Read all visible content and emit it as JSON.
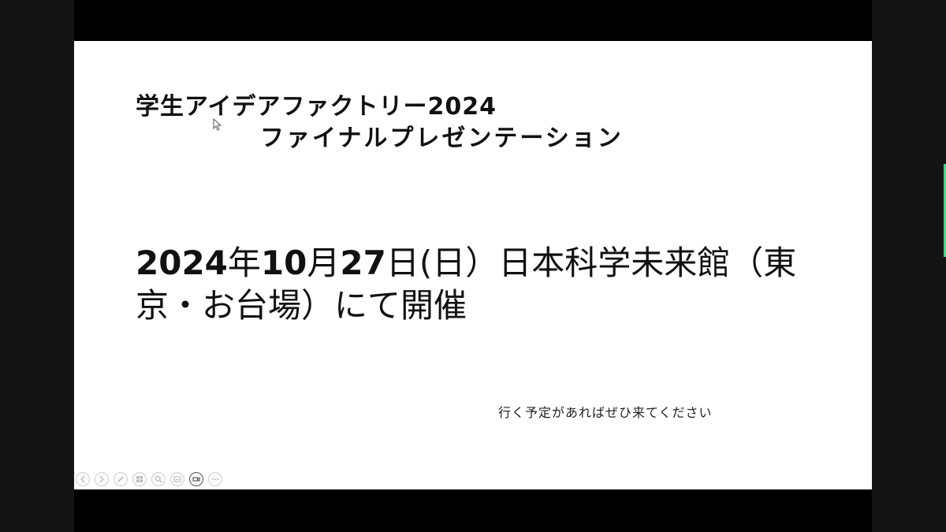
{
  "slide": {
    "title_line1": "学生アイデアファクトリー2024",
    "title_line2": "ファイナルプレゼンテーション",
    "event_info": {
      "year": "2024",
      "year_unit": "年",
      "month": "10",
      "month_unit": "月",
      "day": "27",
      "rest": "日(日）日本科学未来館（東京・お台場）にて開催"
    },
    "note": "行く予定があればぜひ来てください"
  },
  "toolbar": {
    "buttons": [
      {
        "icon": "previous-icon"
      },
      {
        "icon": "next-icon"
      },
      {
        "icon": "pen-icon"
      },
      {
        "icon": "slides-grid-icon"
      },
      {
        "icon": "zoom-icon"
      },
      {
        "icon": "subtitles-icon"
      },
      {
        "icon": "camera-icon"
      },
      {
        "icon": "more-options-icon"
      }
    ]
  },
  "colors": {
    "letterbox": "#000000",
    "side_panel": "#141414",
    "slide_bg": "#ffffff",
    "text": "#111111",
    "indicator": "#3ddc84"
  }
}
